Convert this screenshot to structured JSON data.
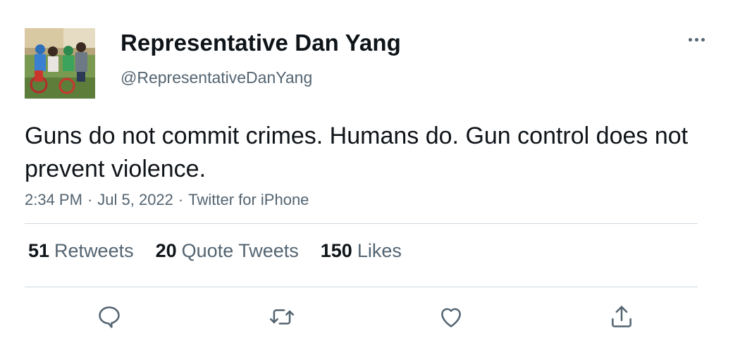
{
  "author": {
    "display_name": "Representative Dan Yang",
    "handle": "@RepresentativeDanYang"
  },
  "tweet": {
    "text": "Guns do not commit crimes. Humans do. Gun control does not prevent violence.",
    "time": "2:34 PM",
    "date": "Jul 5, 2022",
    "source": "Twitter for iPhone",
    "separator": "·"
  },
  "stats": {
    "retweets": {
      "count": "51",
      "label": "Retweets"
    },
    "quote_tweets": {
      "count": "20",
      "label": "Quote Tweets"
    },
    "likes": {
      "count": "150",
      "label": "Likes"
    }
  },
  "actions": [
    "reply-icon",
    "retweet-icon",
    "like-icon",
    "share-icon"
  ],
  "colors": {
    "text": "#0f1419",
    "secondary": "#536471",
    "divider": "#cfd9de"
  }
}
